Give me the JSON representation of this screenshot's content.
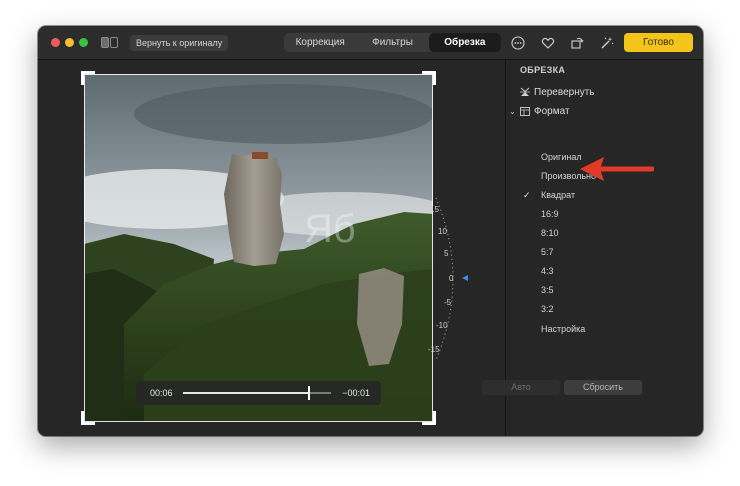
{
  "toolbar": {
    "revert_label": "Вернуть к оригиналу",
    "tabs": [
      "Коррекция",
      "Фильтры",
      "Обрезка"
    ],
    "active_tab": "Обрезка",
    "done_label": "Готово",
    "icons": [
      "more-icon",
      "heart-icon",
      "rotate-icon",
      "magic-wand-icon"
    ]
  },
  "video": {
    "elapsed": "00:06",
    "remaining": "−00:01",
    "progress": 0.85
  },
  "straighten_dial": {
    "labels": [
      "15",
      "10",
      "5",
      "0",
      "-5",
      "-10",
      "-15"
    ],
    "value": "0"
  },
  "crop_panel": {
    "title": "ОБРЕЗКА",
    "flip_label": "Перевернуть",
    "format_label": "Формат",
    "options": [
      "Оригинал",
      "Произвольно",
      "Квадрат",
      "16:9",
      "8:10",
      "5:7",
      "4:3",
      "3:5",
      "3:2",
      "Настройка"
    ],
    "selected": "Квадрат",
    "auto_label": "Авто",
    "reset_label": "Сбросить"
  },
  "colors": {
    "accent": "#f3c51a",
    "annotation_arrow": "#e23a26"
  }
}
